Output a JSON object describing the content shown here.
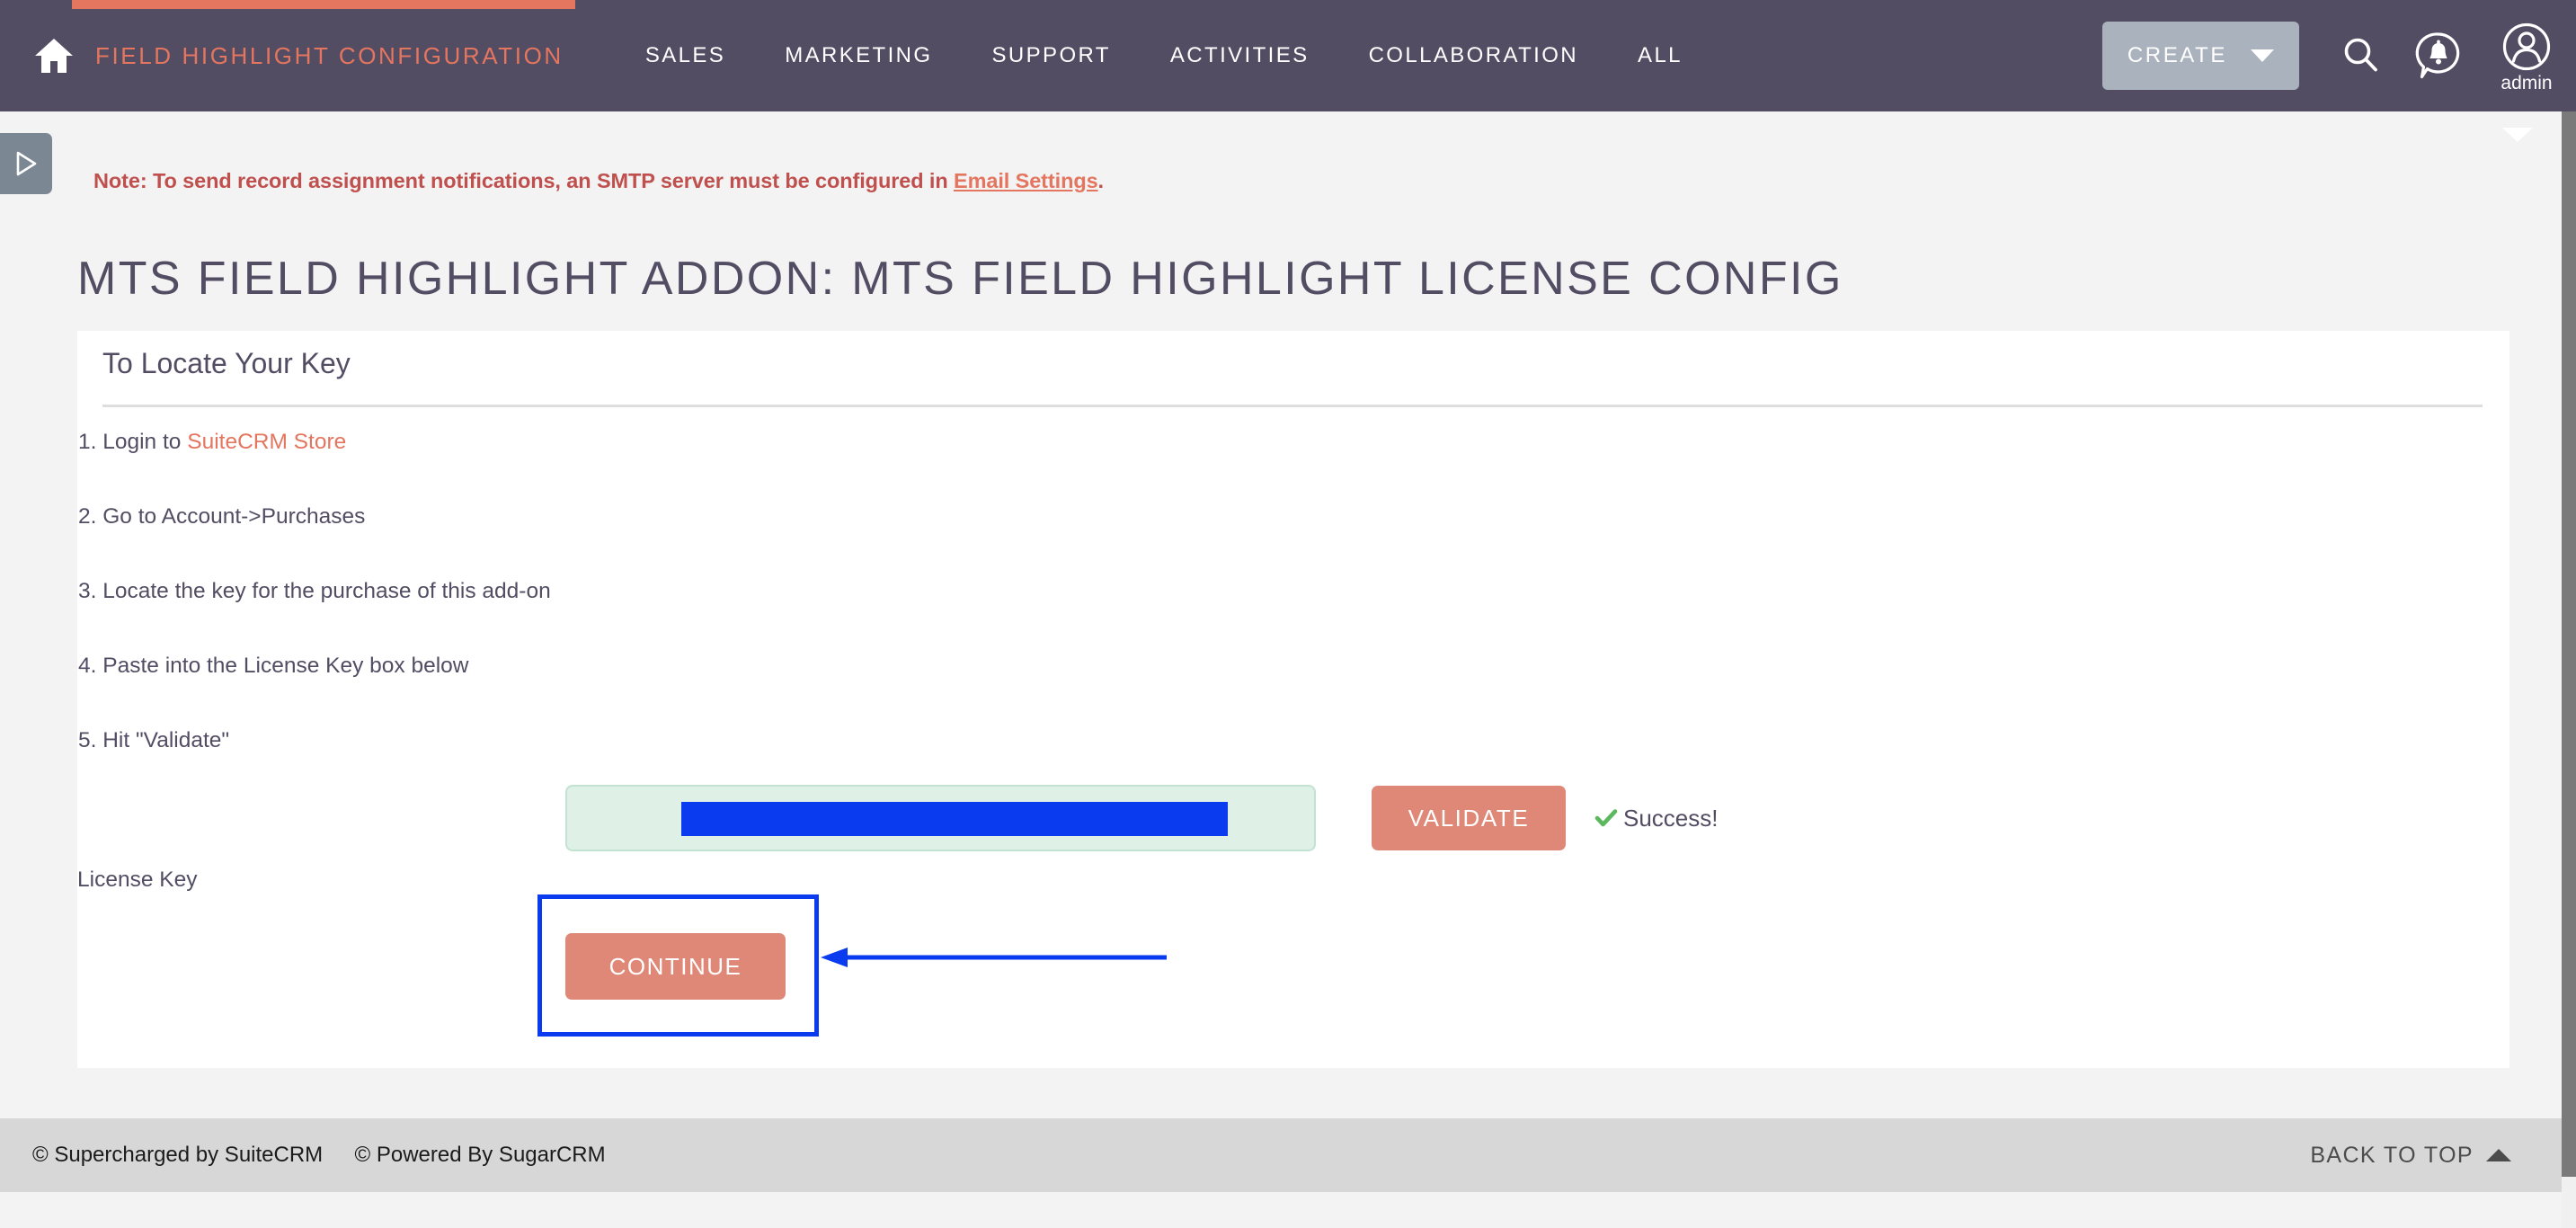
{
  "header": {
    "home_icon": "home-icon",
    "module_title": "FIELD HIGHLIGHT CONFIGURATION",
    "nav_items": [
      {
        "label": "SALES"
      },
      {
        "label": "MARKETING"
      },
      {
        "label": "SUPPORT"
      },
      {
        "label": "ACTIVITIES"
      },
      {
        "label": "COLLABORATION"
      },
      {
        "label": "ALL"
      }
    ],
    "create_label": "CREATE",
    "search_icon": "search-icon",
    "notification_icon": "notification-bell-icon",
    "user_avatar_icon": "user-avatar-icon",
    "user_name": "admin",
    "accent_color": "#e4755f",
    "bar_color": "#534d64"
  },
  "sidebar_toggle": {
    "icon": "play-triangle-right-icon"
  },
  "notice": {
    "text_before": "Note: To send record assignment notifications, an SMTP server must be configured in ",
    "link_label": "Email Settings",
    "text_after": "."
  },
  "page": {
    "title": "MTS FIELD HIGHLIGHT ADDON: MTS FIELD HIGHLIGHT LICENSE CONFIG"
  },
  "panel": {
    "header": "To Locate Your Key",
    "steps": [
      {
        "prefix": "1. Login to ",
        "link": "SuiteCRM Store",
        "suffix": ""
      },
      {
        "prefix": "2. Go to Account->Purchases",
        "link": "",
        "suffix": ""
      },
      {
        "prefix": "3. Locate the key for the purchase of this add-on",
        "link": "",
        "suffix": ""
      },
      {
        "prefix": "4. Paste into the License Key box below",
        "link": "",
        "suffix": ""
      },
      {
        "prefix": "5. Hit \"Validate\"",
        "link": "",
        "suffix": ""
      }
    ],
    "license_key_label": "License Key",
    "license_key_value": "",
    "license_key_placeholder": "",
    "validate_label": "VALIDATE",
    "success_label": "Success!",
    "success_color": "#5cb85c",
    "continue_label": "CONTINUE",
    "button_color": "#e08878"
  },
  "annotation": {
    "highlight_color": "#0a3bef",
    "arrow": "left-pointing-arrow"
  },
  "footer": {
    "copy_suitecrm": "© Supercharged by SuiteCRM",
    "copy_sugarcrm": "© Powered By SugarCRM",
    "back_to_top": "BACK TO TOP"
  }
}
